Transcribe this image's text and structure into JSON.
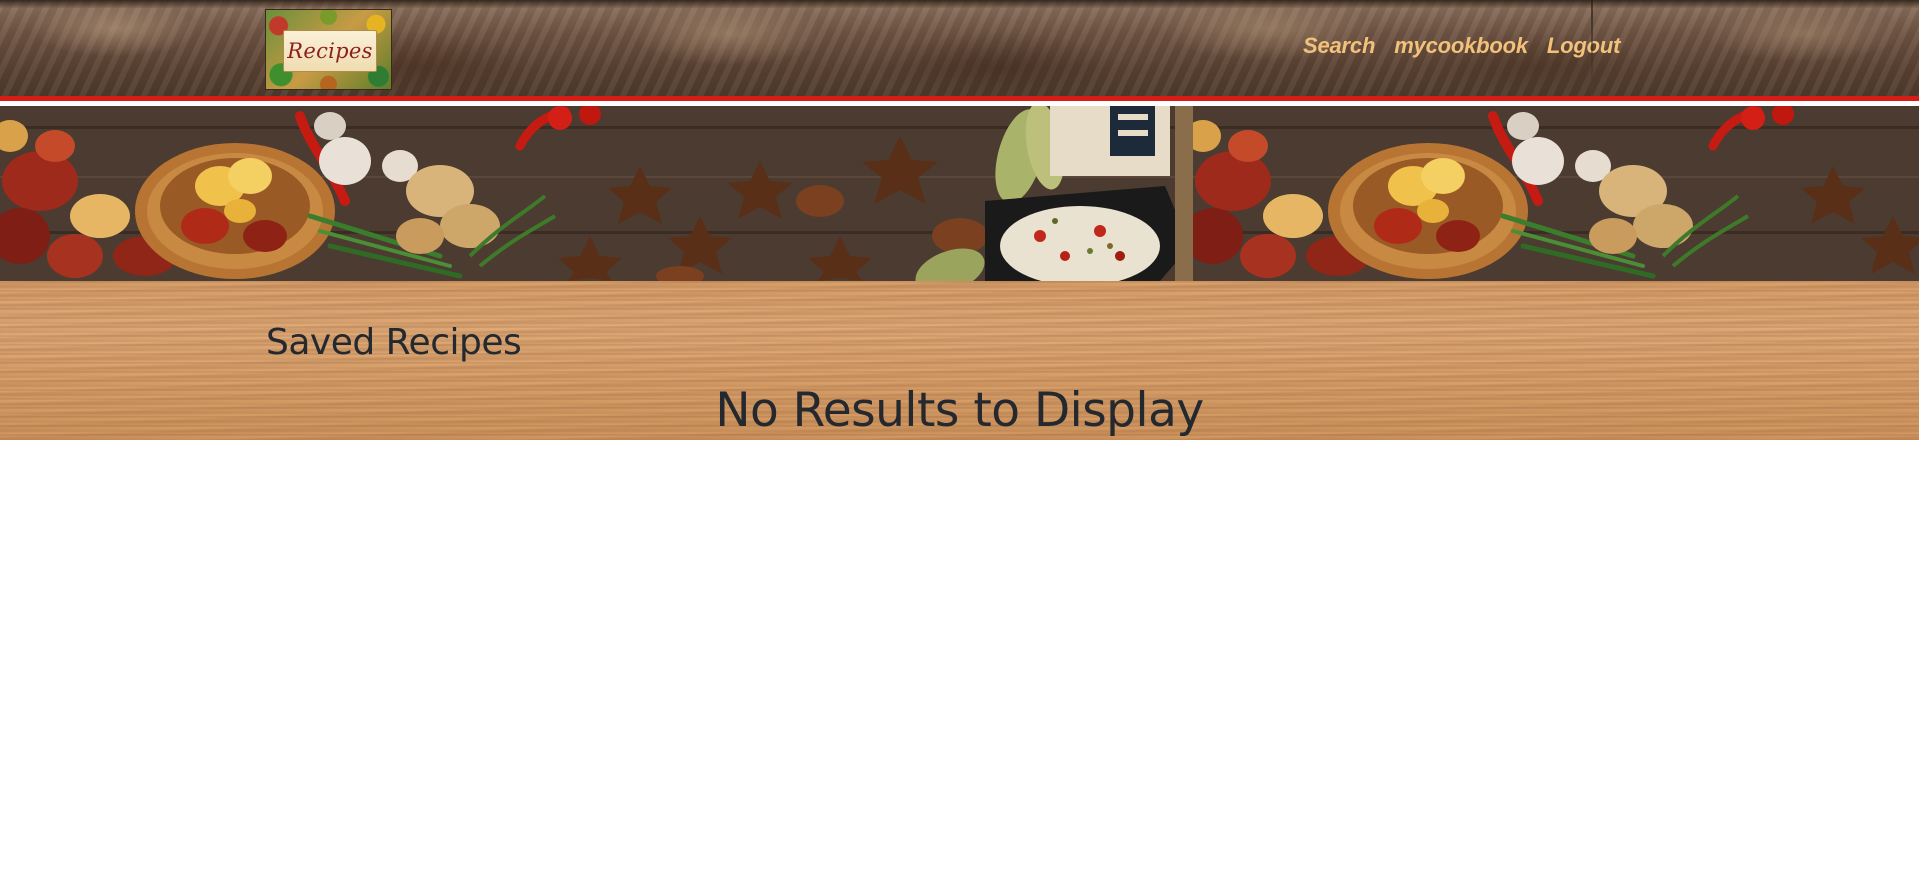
{
  "navbar": {
    "logo_text": "Recipes",
    "links": [
      {
        "label": "Search"
      },
      {
        "label": "mycookbook"
      },
      {
        "label": "Logout"
      }
    ]
  },
  "colors": {
    "nav_link": "#f2c27a",
    "accent_border": "#d81b14",
    "heading": "#24292f"
  },
  "main": {
    "page_title": "Saved Recipes",
    "empty_message": "No Results to Display"
  }
}
